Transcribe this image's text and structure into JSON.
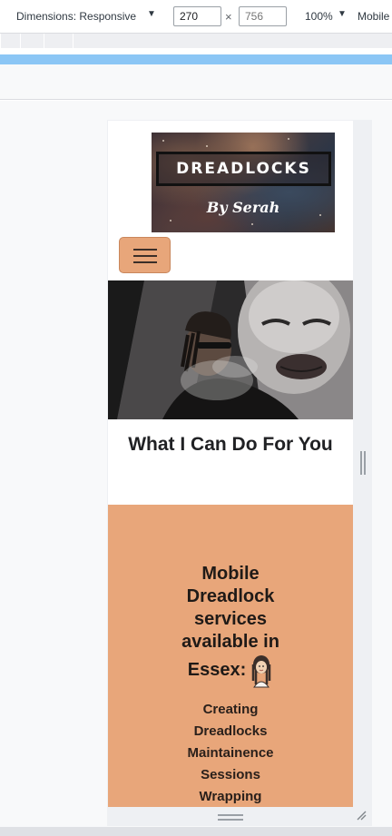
{
  "devtools": {
    "dimensions_label": "Dimensions: Responsive",
    "caret": "▼",
    "width_value": "270",
    "height_value": "756",
    "times": "×",
    "zoom": "100%",
    "device_label": "Mobile"
  },
  "colors": {
    "accent": "#e8a67a",
    "media_query_bar": "#8bc6f5",
    "text_dark": "#202124"
  },
  "site": {
    "logo": {
      "title": "DREADLOCKS",
      "subtitle": "By Serah"
    },
    "menu_icon": "hamburger-menu-icon",
    "section_heading": "What I Can Do For You",
    "services": {
      "heading": "Mobile Dreadlock services available in Essex:",
      "heading_icon": "woman-with-dreadlocks-icon",
      "items": [
        "Creating",
        "Dreadlocks",
        "Maintainence",
        "Sessions",
        "Wrapping"
      ]
    }
  }
}
